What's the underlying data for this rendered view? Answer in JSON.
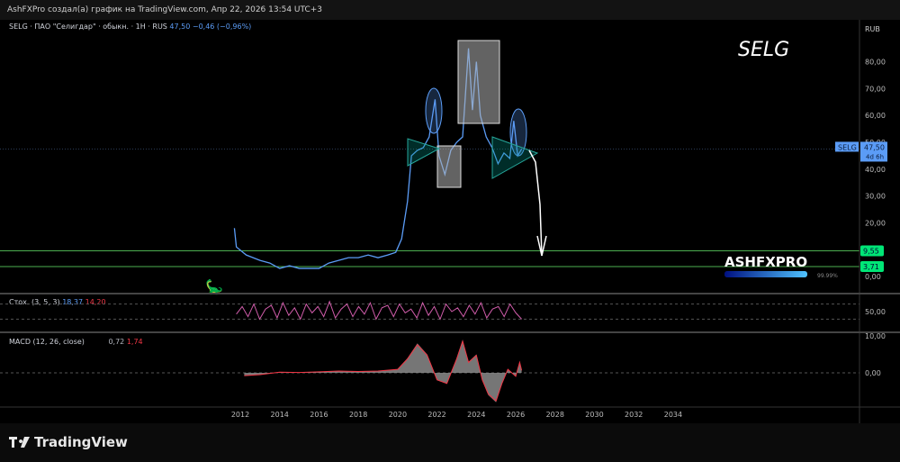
{
  "header": {
    "title": "AshFXPro создал(а) график на TradingView.com, Апр 22, 2026 13:54 UTC+3"
  },
  "legend": {
    "symbol": "SELG · ПАО \"Селигдар\" · обыкн. · 1H · RUS",
    "price": "47,50",
    "change": "−0,46 (−0,96%)"
  },
  "stoch": {
    "label": "Стох. (3, 5, 3)",
    "k": "18,37",
    "d": "14,20"
  },
  "macd": {
    "label": "MACD (12, 26, close)",
    "macd": "0,72",
    "signal": "1,74"
  },
  "annotations": {
    "ticker_text": "SELG",
    "logo_text": "ASHFXPRO",
    "logo_pct": "99.99%",
    "logo_progress": 0.9999
  },
  "price_axis": {
    "currency": "RUB",
    "ticks": [
      "80,00",
      "70,00",
      "60,00",
      "50,00",
      "40,00",
      "30,00",
      "20,00",
      "0,00"
    ],
    "last_label": "SELG",
    "last_price": "47,50",
    "countdown": "4d 6h",
    "level1": "9,55",
    "level2": "3,71"
  },
  "stoch_axis": {
    "ticks": [
      "50,00"
    ]
  },
  "macd_axis": {
    "ticks": [
      "10,00",
      "0,00"
    ]
  },
  "time_axis": {
    "ticks": [
      "2012",
      "2014",
      "2016",
      "2018",
      "2020",
      "2022",
      "2024",
      "2026",
      "2028",
      "2030",
      "2032",
      "2034"
    ]
  },
  "footer": {
    "brand": "TradingView"
  },
  "colors": {
    "price_line": "#5b9cf6",
    "level": "#4caf50",
    "level_label": "#00e676",
    "stoch_k": "#d15dab",
    "macd_hist": "#9e9e9e",
    "macd_line": "#f23645"
  },
  "chart_data": {
    "type": "line",
    "price_scale": [
      0,
      80
    ],
    "price": {
      "x": [
        2011.7,
        2011.8,
        2012.3,
        2013,
        2013.5,
        2014,
        2014.5,
        2015,
        2015.5,
        2016,
        2016.5,
        2017,
        2017.5,
        2018,
        2018.5,
        2019,
        2019.5,
        2019.9,
        2020.2,
        2020.5,
        2020.7,
        2021,
        2021.3,
        2021.6,
        2021.9,
        2022.1,
        2022.4,
        2022.7,
        2023,
        2023.3,
        2023.6,
        2023.8,
        2024,
        2024.2,
        2024.5,
        2024.8,
        2025.1,
        2025.4,
        2025.7,
        2025.9,
        2026.1,
        2026.3
      ],
      "y": [
        18,
        11,
        8,
        6,
        5,
        3,
        4,
        3,
        3,
        3,
        5,
        6,
        7,
        7,
        8,
        7,
        8,
        9,
        14,
        28,
        45,
        47,
        48,
        52,
        66,
        45,
        38,
        47,
        50,
        52,
        85,
        62,
        80,
        60,
        52,
        48,
        42,
        46,
        44,
        58,
        45,
        47.5
      ]
    },
    "levels": [
      9.55,
      3.71
    ],
    "stoch_k": {
      "x0": 2011.8,
      "x1": 2026.3,
      "values": [
        40,
        70,
        30,
        80,
        20,
        60,
        75,
        25,
        85,
        35,
        65,
        20,
        80,
        45,
        70,
        30,
        90,
        25,
        60,
        80,
        30,
        70,
        40,
        85,
        20,
        65,
        75,
        30,
        80,
        45,
        60,
        25,
        85,
        35,
        70,
        20,
        80,
        50,
        65,
        30,
        75,
        40,
        85,
        25,
        60,
        70,
        30,
        80,
        45,
        20
      ]
    },
    "macd_hist": {
      "x": [
        2012.2,
        2013,
        2014,
        2015,
        2016,
        2017,
        2018,
        2019,
        2020,
        2020.5,
        2021,
        2021.5,
        2022,
        2022.5,
        2023,
        2023.3,
        2023.6,
        2024,
        2024.3,
        2024.6,
        2025,
        2025.3,
        2025.6,
        2026,
        2026.2,
        2026.3
      ],
      "y": [
        -0.8,
        -0.5,
        0.2,
        0.1,
        0.3,
        0.5,
        0.4,
        0.5,
        1,
        4,
        8,
        5,
        -2,
        -3,
        4,
        9,
        3,
        5,
        -2,
        -6,
        -8,
        -3,
        1,
        -1,
        3,
        0.7
      ]
    }
  }
}
